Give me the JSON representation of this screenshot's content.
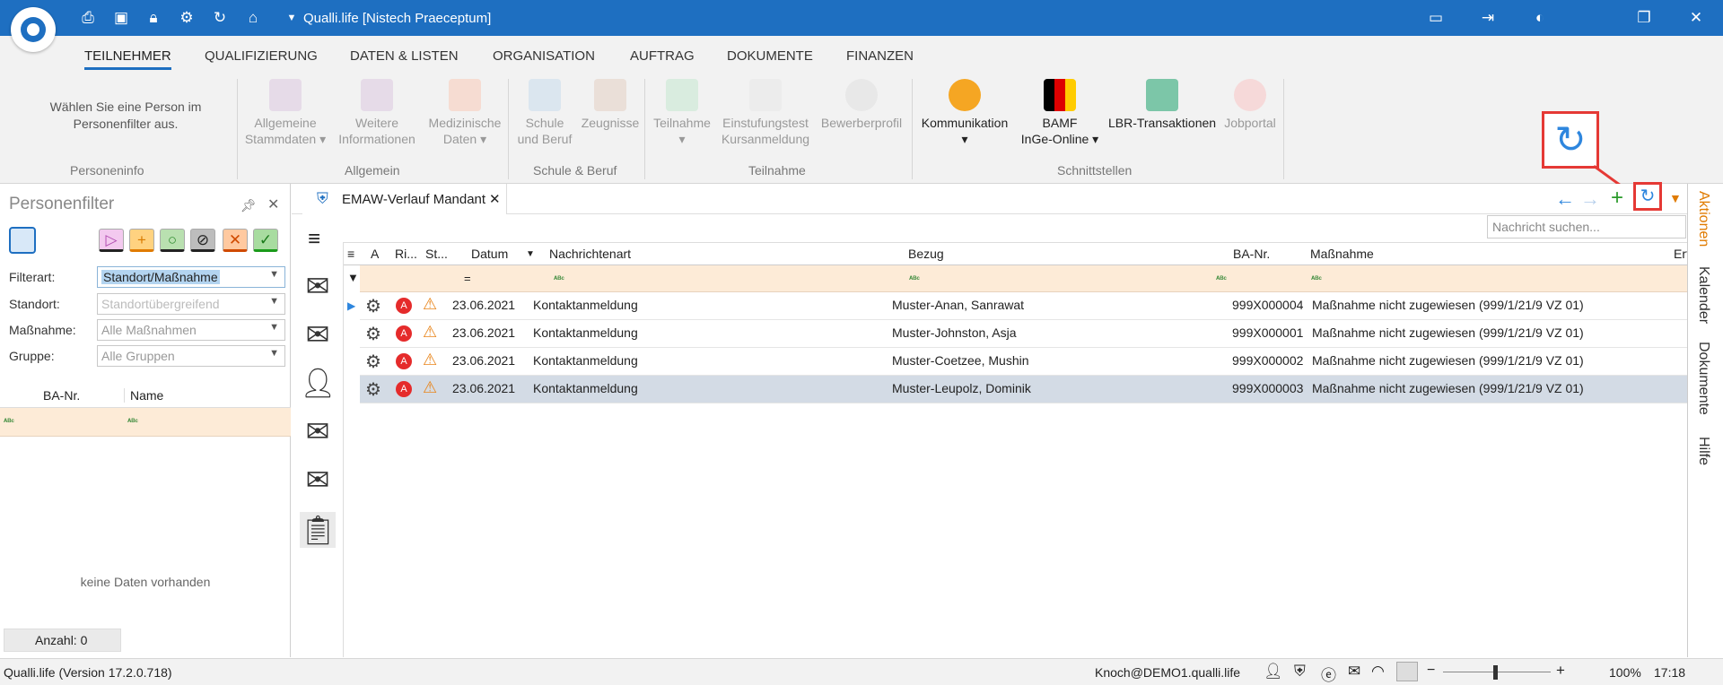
{
  "window": {
    "title": "Qualli.life [Nistech Praeceptum]"
  },
  "ribbon": {
    "tabs": [
      "TEILNEHMER",
      "QUALIFIZIERUNG",
      "DATEN & LISTEN",
      "ORGANISATION",
      "AUFTRAG",
      "DOKUMENTE",
      "FINANZEN"
    ],
    "hint": "Wählen Sie eine Person im Personenfilter aus.",
    "groups": [
      "Personeninfo",
      "Allgemein",
      "Schule & Beruf",
      "Teilnahme",
      "Schnittstellen"
    ],
    "buttons": [
      {
        "l1": "Allgemeine",
        "l2": "Stammdaten ▾"
      },
      {
        "l1": "Weitere",
        "l2": "Informationen"
      },
      {
        "l1": "Medizinische",
        "l2": "Daten ▾"
      },
      {
        "l1": "Schule",
        "l2": "und Beruf"
      },
      {
        "l1": "Zeugnisse",
        "l2": ""
      },
      {
        "l1": "Teilnahme",
        "l2": "▾"
      },
      {
        "l1": "Einstufungstest",
        "l2": "Kursanmeldung"
      },
      {
        "l1": "Bewerberprofil",
        "l2": ""
      },
      {
        "l1": "Kommunikation",
        "l2": "▾"
      },
      {
        "l1": "BAMF",
        "l2": "InGe-Online ▾"
      },
      {
        "l1": "LBR-Transaktionen",
        "l2": ""
      },
      {
        "l1": "Jobportal",
        "l2": ""
      }
    ]
  },
  "filter_panel": {
    "title": "Personenfilter",
    "labels": [
      "Filterart:",
      "Standort:",
      "Maßnahme:",
      "Gruppe:"
    ],
    "values": [
      "Standort/Maßnahme",
      "Standortübergreifend",
      "Alle Maßnahmen",
      "Alle Gruppen"
    ],
    "columns": [
      "BA-Nr.",
      "Name"
    ],
    "empty": "keine Daten vorhanden",
    "count": "Anzahl: 0"
  },
  "doc_tab": {
    "label": "EMAW-Verlauf Mandant"
  },
  "search": {
    "placeholder": "Nachricht suchen..."
  },
  "grid": {
    "columns": [
      "A",
      "Ri...",
      "St...",
      "Datum",
      "Nachrichtenart",
      "Bezug",
      "BA-Nr.",
      "Maßnahme",
      "Erf"
    ],
    "rows": [
      {
        "datum": "23.06.2021",
        "art": "Kontaktanmeldung",
        "bezug": "Muster-Anan, Sanrawat",
        "ba": "999X000004",
        "massnahme": "Maßnahme nicht zugewiesen (999/1/21/9 VZ 01)"
      },
      {
        "datum": "23.06.2021",
        "art": "Kontaktanmeldung",
        "bezug": "Muster-Johnston, Asja",
        "ba": "999X000001",
        "massnahme": "Maßnahme nicht zugewiesen (999/1/21/9 VZ 01)"
      },
      {
        "datum": "23.06.2021",
        "art": "Kontaktanmeldung",
        "bezug": "Muster-Coetzee, Mushin",
        "ba": "999X000002",
        "massnahme": "Maßnahme nicht zugewiesen (999/1/21/9 VZ 01)"
      },
      {
        "datum": "23.06.2021",
        "art": "Kontaktanmeldung",
        "bezug": "Muster-Leupolz, Dominik",
        "ba": "999X000003",
        "massnahme": "Maßnahme nicht zugewiesen (999/1/21/9 VZ 01)"
      }
    ]
  },
  "side_tabs": [
    "Aktionen",
    "Kalender",
    "Dokumente",
    "Hilfe"
  ],
  "status": {
    "version": "Qualli.life (Version 17.2.0.718)",
    "user": "Knoch@DEMO1.qualli.life",
    "zoom": "100%",
    "time": "17:18"
  },
  "colors": {
    "accent": "#1e6fc1",
    "filter_row": "#fdebd7",
    "selected_row": "#d3dbe5",
    "callout": "#e53935"
  }
}
